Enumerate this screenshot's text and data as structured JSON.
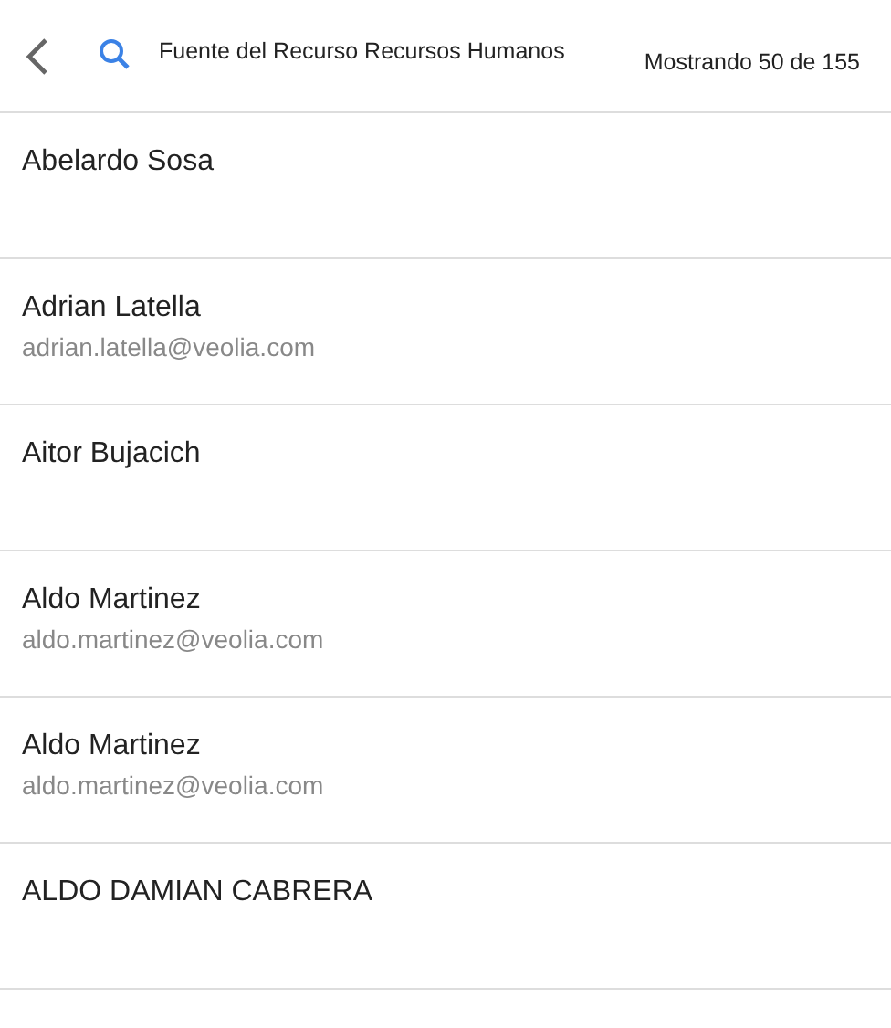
{
  "header": {
    "search_text": "Fuente del Recurso Recursos Humanos",
    "count": "Mostrando 50 de 155"
  },
  "contacts": [
    {
      "name": "Abelardo Sosa"
    },
    {
      "name": "Adrian Latella",
      "email": "adrian.latella@veolia.com"
    },
    {
      "name": "Aitor Bujacich"
    },
    {
      "name": "Aldo Martinez",
      "email": "aldo.martinez@veolia.com"
    },
    {
      "name": "Aldo Martinez",
      "email": "aldo.martinez@veolia.com"
    },
    {
      "name": "ALDO DAMIAN CABRERA"
    }
  ]
}
